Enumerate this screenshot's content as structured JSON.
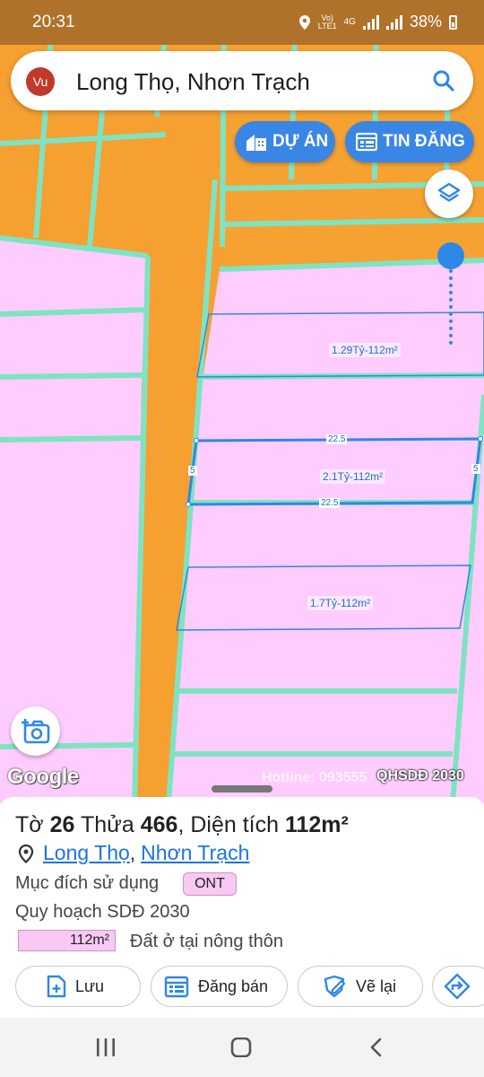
{
  "status_bar": {
    "time": "20:31",
    "network_top": "Vo)",
    "network_bottom": "LTE1",
    "network_type": "4G",
    "battery": "38%"
  },
  "search": {
    "avatar": "Vu",
    "query": "Long Thọ, Nhơn Trạch",
    "icon": "search-icon"
  },
  "map_buttons": {
    "du_an": "DỰ ÁN",
    "tin_dang": "TIN ĐĂNG"
  },
  "parcels": [
    {
      "label": "1.29Tỷ-112m²"
    },
    {
      "label": "2.1Tỷ-112m²"
    },
    {
      "label": "1.7Tỷ-112m²"
    }
  ],
  "dimensions": {
    "top": "22.5",
    "bottom": "22.5",
    "left": "5",
    "right": "5"
  },
  "map_overlay": {
    "google": "Google",
    "hotline": "Hotline: 093555",
    "plan_badge": "QHSDĐ 2030"
  },
  "sheet": {
    "title_to": "Tờ",
    "title_to_value": "26",
    "title_thua": "Thửa",
    "title_thua_value": "466",
    "title_area_label": ", Diện tích",
    "title_area_value": "112m²",
    "location_ward": "Long Thọ",
    "location_district": "Nhơn Trạch",
    "purpose_label": "Mục đích sử dụng",
    "purpose_code": "ONT",
    "plan_label": "Quy hoạch SDĐ 2030",
    "plan_area": "112m²",
    "plan_desc": "Đất ở tại nông thôn"
  },
  "actions": {
    "save": "Lưu",
    "sell": "Đăng bán",
    "redraw": "Vẽ lại"
  },
  "colors": {
    "road": "#f5a030",
    "residential": "#ffccff",
    "boundary": "#7fe3c2",
    "accent": "#3a86e4"
  }
}
